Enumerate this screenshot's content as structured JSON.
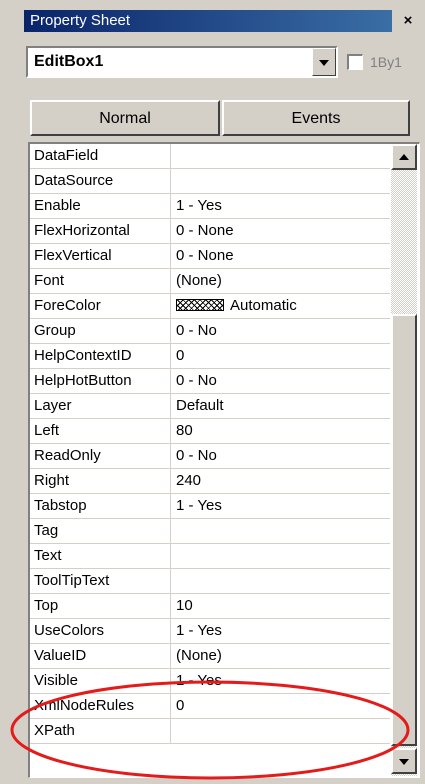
{
  "window": {
    "title": "Property Sheet",
    "close_label": "×"
  },
  "object_selector": {
    "value": "EditBox1"
  },
  "checkbox": {
    "label": "1By1",
    "checked": false,
    "enabled": false
  },
  "tabs": [
    {
      "label": "Normal",
      "active": true
    },
    {
      "label": "Events",
      "active": false
    }
  ],
  "properties": [
    {
      "name": "DataField",
      "value": ""
    },
    {
      "name": "DataSource",
      "value": ""
    },
    {
      "name": "Enable",
      "value": "1 - Yes"
    },
    {
      "name": "FlexHorizontal",
      "value": "0 - None"
    },
    {
      "name": "FlexVertical",
      "value": "0 - None"
    },
    {
      "name": "Font",
      "value": "(None)"
    },
    {
      "name": "ForeColor",
      "value": "Automatic",
      "swatch": true
    },
    {
      "name": "Group",
      "value": "0 - No"
    },
    {
      "name": "HelpContextID",
      "value": "0"
    },
    {
      "name": "HelpHotButton",
      "value": "0 - No"
    },
    {
      "name": "Layer",
      "value": "Default"
    },
    {
      "name": "Left",
      "value": "80"
    },
    {
      "name": "ReadOnly",
      "value": "0 - No"
    },
    {
      "name": "Right",
      "value": "240"
    },
    {
      "name": "Tabstop",
      "value": "1 - Yes"
    },
    {
      "name": "Tag",
      "value": ""
    },
    {
      "name": "Text",
      "value": ""
    },
    {
      "name": "ToolTipText",
      "value": ""
    },
    {
      "name": "Top",
      "value": "10"
    },
    {
      "name": "UseColors",
      "value": "1 - Yes"
    },
    {
      "name": "ValueID",
      "value": "(None)"
    },
    {
      "name": "Visible",
      "value": "1 - Yes"
    },
    {
      "name": "XmlNodeRules",
      "value": "0"
    },
    {
      "name": "XPath",
      "value": ""
    }
  ],
  "colors": {
    "annotation": "#e31b1b",
    "title_bar": "#0a246a",
    "face": "#d4d0c8"
  }
}
